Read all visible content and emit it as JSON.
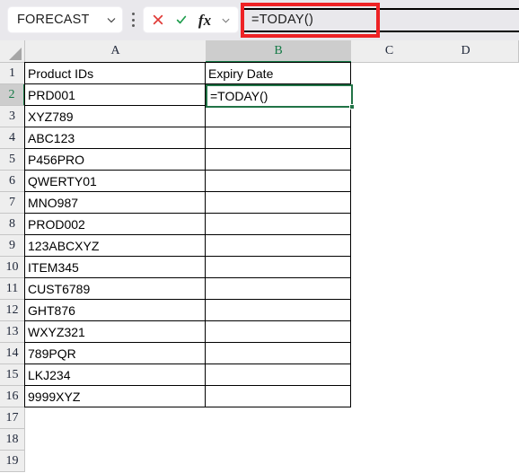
{
  "formula_bar": {
    "name_box_value": "FORECAST",
    "name_box_dropdown_icon": "chevron-down-icon",
    "more_options_icon": "kebab-menu-icon",
    "cancel_icon": "cancel-x-icon",
    "enter_icon": "confirm-check-icon",
    "insert_function_label": "fx",
    "expand_icon": "chevron-down-icon",
    "formula_value": "=TODAY()",
    "highlight_color": "#ee2225",
    "cancel_color": "#e03a36",
    "enter_color": "#1f9d4d"
  },
  "sheet": {
    "columns": [
      "A",
      "B",
      "C",
      "D"
    ],
    "selected_column": "B",
    "rows": [
      "1",
      "2",
      "3",
      "4",
      "5",
      "6",
      "7",
      "8",
      "9",
      "10",
      "11",
      "12",
      "13",
      "14",
      "15",
      "16",
      "17",
      "18",
      "19"
    ],
    "selected_row": "2",
    "active_cell": "B2",
    "active_cell_value": "=TODAY()",
    "accent_color": "#217346",
    "headers": {
      "a": "Product IDs",
      "b": "Expiry Date"
    },
    "product_ids": [
      "PRD001",
      "XYZ789",
      "ABC123",
      "P456PRO",
      "QWERTY01",
      "MNO987",
      "PROD002",
      "123ABCXYZ",
      "ITEM345",
      "CUST6789",
      "GHT876",
      "WXYZ321",
      "789PQR",
      "LKJ234",
      "9999XYZ"
    ],
    "expiry_dates": [
      "",
      "",
      "",
      "",
      "",
      "",
      "",
      "",
      "",
      "",
      "",
      "",
      "",
      ""
    ]
  }
}
